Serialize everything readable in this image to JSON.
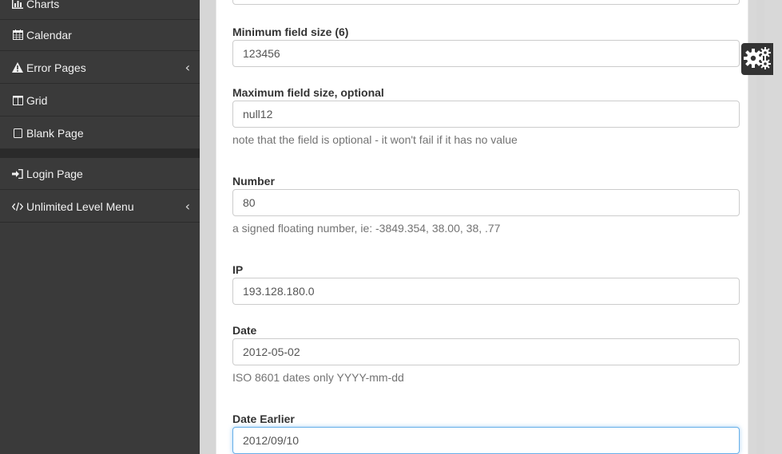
{
  "sidebar": {
    "items": [
      {
        "label": "Charts",
        "icon": "bar-chart-icon"
      },
      {
        "label": "Calendar",
        "icon": "calendar-icon"
      },
      {
        "label": "Error Pages",
        "icon": "warning-icon",
        "has_submenu": true
      },
      {
        "label": "Grid",
        "icon": "grid-icon"
      },
      {
        "label": "Blank Page",
        "icon": "blank-page-icon"
      },
      {
        "label": "Login Page",
        "icon": "sign-in-icon"
      },
      {
        "label": "Unlimited Level Menu",
        "icon": "code-icon",
        "has_submenu": true
      }
    ],
    "chevron": "‹"
  },
  "form": {
    "min_size": {
      "label": "Minimum field size (6)",
      "value": "123456"
    },
    "max_size": {
      "label": "Maximum field size, optional",
      "value": "null12",
      "help": "note that the field is optional - it won't fail if it has no value"
    },
    "number": {
      "label": "Number",
      "value": "80",
      "help": "a signed floating number, ie: -3849.354, 38.00, 38, .77"
    },
    "ip": {
      "label": "IP",
      "value": "193.128.180.0"
    },
    "date": {
      "label": "Date",
      "value": "2012-05-02",
      "help": "ISO 8601 dates only YYYY-mm-dd"
    },
    "date_earlier": {
      "label": "Date Earlier",
      "value": "2012/09/10"
    }
  },
  "settings_button": {
    "icon": "gears-icon"
  },
  "colors": {
    "sidebar_bg": "#3a3a3a",
    "focus_border": "#66afe9"
  }
}
